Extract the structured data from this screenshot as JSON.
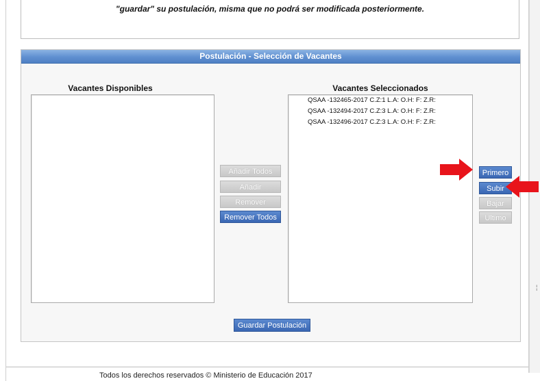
{
  "notice": {
    "text": "\"guardar\" su postulación, misma que no podrá ser modificada posteriormente."
  },
  "panel": {
    "title": "Postulación - Selección de Vacantes",
    "available_title": "Vacantes Disponibles",
    "selected_title": "Vacantes Seleccionados",
    "available_items": [],
    "selected_items": [
      "QSAA -132465-2017 C.Z:1 L.A: O.H: F: Z.R:",
      "QSAA -132494-2017 C.Z:3 L.A: O.H: F: Z.R:",
      "QSAA -132496-2017 C.Z:3 L.A: O.H: F: Z.R:"
    ]
  },
  "transfer_buttons": {
    "add_all": "Añadir Todos",
    "add": "Añadir",
    "remove": "Remover",
    "remove_all": "Remover Todos"
  },
  "order_buttons": {
    "first": "Primero",
    "up": "Subir",
    "down": "Bajar",
    "last": "Ultimo"
  },
  "save_button": "Guardar Postulación",
  "footer": {
    "text": "Todos los derechos reservados © Ministerio de Educación 2017"
  },
  "colors": {
    "header_blue": "#5f8fd0",
    "button_blue": "#3a67b3",
    "annotation_red": "#e8141b"
  },
  "icons": [
    "red-arrow-icon"
  ]
}
